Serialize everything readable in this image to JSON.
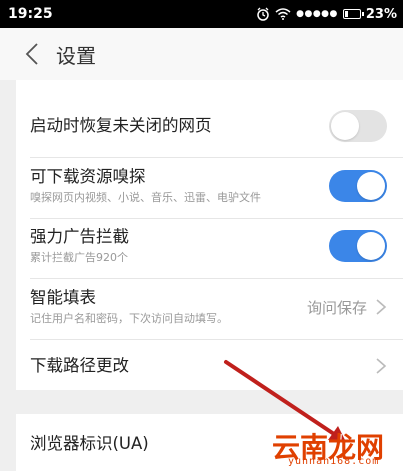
{
  "status_bar": {
    "time": "19:25",
    "signal": "●●●●●",
    "battery_text": "23%"
  },
  "header": {
    "back_label": "",
    "title": "设置"
  },
  "settings": [
    {
      "title": "启动时恢复未关闭的网页",
      "subtitle": "",
      "toggle": false
    },
    {
      "title": "可下载资源嗅探",
      "subtitle": "嗅探网页内视频、小说、音乐、迅雷、电驴文件",
      "toggle": true
    },
    {
      "title": "强力广告拦截",
      "subtitle": "累计拦截广告920个",
      "toggle": true
    },
    {
      "title": "智能填表",
      "subtitle": "记住用户名和密码，下次访问自动填写。",
      "value": "询问保存"
    },
    {
      "title": "下载路径更改",
      "subtitle": ""
    },
    {
      "title": "浏览器标识(UA)",
      "subtitle": ""
    }
  ],
  "watermark": {
    "text": "云南龙网",
    "sub": "yunnan168.com"
  },
  "colors": {
    "accent": "#3b86e8",
    "background": "#efefef",
    "arrow": "#c0201c",
    "watermark": "#e04000"
  }
}
